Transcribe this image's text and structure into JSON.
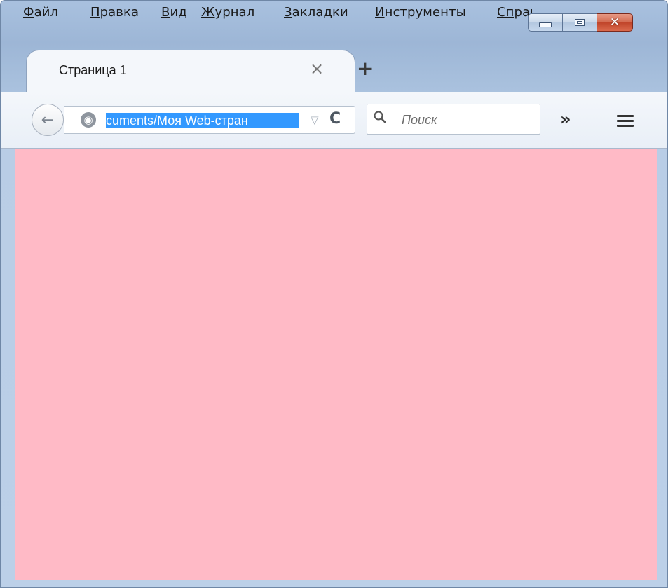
{
  "menu": {
    "items": [
      {
        "mnemonic": "Ф",
        "rest": "айл"
      },
      {
        "mnemonic": "П",
        "rest": "равка"
      },
      {
        "mnemonic": "В",
        "rest": "ид"
      },
      {
        "mnemonic": "Ж",
        "rest": "урнал"
      },
      {
        "mnemonic": "З",
        "rest": "акладки"
      },
      {
        "mnemonic": "И",
        "rest": "нструменты"
      },
      {
        "mnemonic": "Сп",
        "rest": "равка"
      }
    ]
  },
  "window_controls": {
    "minimize_icon": "minimize-icon",
    "maximize_icon": "maximize-icon",
    "close_icon": "close-icon"
  },
  "tab": {
    "title": "Страница 1",
    "close_glyph": "×"
  },
  "new_tab": {
    "glyph": "+"
  },
  "nav": {
    "back_glyph": "←",
    "url_text": "cuments/Моя Web-стран",
    "dropmarker_glyph": "▽",
    "reload_glyph": "C",
    "search_placeholder": "Поиск",
    "overflow_glyph": "»"
  },
  "content": {
    "background": "#ffbac6"
  },
  "colors": {
    "selection": "#3399ff",
    "close_button": "#c9452c"
  }
}
